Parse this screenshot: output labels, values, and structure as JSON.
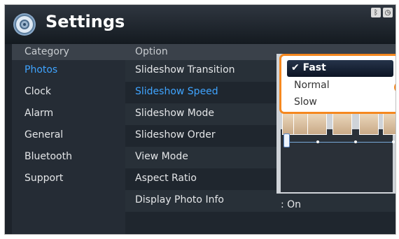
{
  "header": {
    "title": "Settings"
  },
  "status_icons": [
    "bluetooth-icon",
    "clock-icon"
  ],
  "columns": {
    "category_header": "Category",
    "option_header": "Option"
  },
  "categories": [
    {
      "label": "Photos",
      "selected": true
    },
    {
      "label": "Clock"
    },
    {
      "label": "Alarm"
    },
    {
      "label": "General"
    },
    {
      "label": "Bluetooth"
    },
    {
      "label": "Support"
    }
  ],
  "options": [
    {
      "label": "Slideshow Transition"
    },
    {
      "label": "Slideshow Speed",
      "selected": true
    },
    {
      "label": "Slideshow Mode"
    },
    {
      "label": "Slideshow Order"
    },
    {
      "label": "View Mode"
    },
    {
      "label": "Aspect Ratio"
    },
    {
      "label": "Display Photo Info",
      "value": ": On"
    }
  ],
  "popup": {
    "selected_label": "Fast",
    "check_glyph": "✔",
    "items": [
      "Normal",
      "Slow"
    ]
  },
  "colors": {
    "accent": "#3fa4ff",
    "callout": "#f5881f",
    "background": "#1d232b"
  }
}
